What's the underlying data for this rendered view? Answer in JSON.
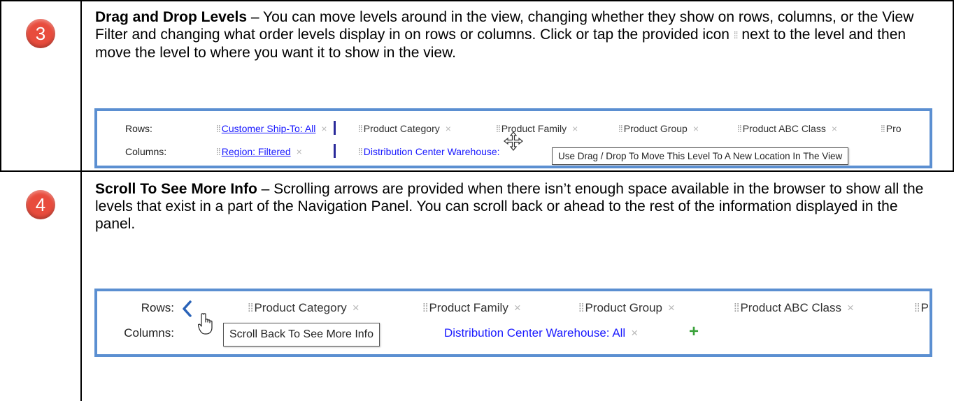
{
  "steps": [
    {
      "number": "3",
      "title": "Drag and Drop Levels",
      "body_part1": " – You can move levels around in the view, changing whether they show on rows, columns, or the View Filter and changing what order levels display in on rows or columns. Click or tap the provided icon ",
      "body_part2": " next to the level and then move the level to where you want it to show in the view.",
      "panel": {
        "rows_label": "Rows:",
        "columns_label": "Columns:",
        "rows_chips": [
          "Customer Ship-To: All",
          "Product Category",
          "Product Family",
          "Product Group",
          "Product ABC Class",
          "Pro"
        ],
        "columns_chips": [
          "Region: Filtered",
          "Distribution Center Warehouse:"
        ],
        "tooltip": "Use Drag / Drop To Move This Level To A New Location In The View"
      }
    },
    {
      "number": "4",
      "title": "Scroll To See More Info",
      "body": " – Scrolling arrows are provided when there isn’t enough space available in the browser to show all the levels that exist in a part of the Navigation Panel. You can scroll back or ahead to the rest of the information displayed in the panel.",
      "panel": {
        "rows_label": "Rows:",
        "columns_label": "Columns:",
        "rows_chips": [
          "Product Category",
          "Product Family",
          "Product Group",
          "Product ABC Class",
          "Pr"
        ],
        "columns_chips": [
          "Distribution Center Warehouse: All"
        ],
        "tooltip": "Scroll Back To See More Info",
        "plus": "+"
      }
    }
  ],
  "glyphs": {
    "grip": "⁞⁞",
    "close": "×"
  },
  "colors": {
    "badge": "#e84c3d",
    "panel_border": "#5b8fd1",
    "link": "#1a1aff",
    "plus": "#3aa23a"
  }
}
